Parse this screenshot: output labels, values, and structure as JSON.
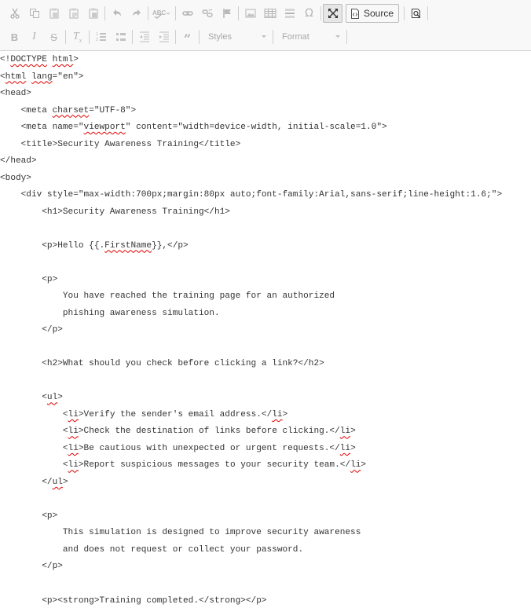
{
  "toolbar": {
    "row1": [
      {
        "name": "cut-button",
        "icon": "scissors-icon"
      },
      {
        "name": "copy-button",
        "icon": "copy-icon"
      },
      {
        "name": "paste-button",
        "icon": "paste-icon"
      },
      {
        "name": "paste-as-text-button",
        "icon": "paste-text-icon"
      },
      {
        "name": "paste-from-word-button",
        "icon": "paste-word-icon"
      },
      {
        "name": "undo-button",
        "icon": "undo-icon"
      },
      {
        "name": "redo-button",
        "icon": "redo-icon"
      },
      {
        "name": "spellcheck-button",
        "icon": "spellcheck-icon"
      },
      {
        "name": "link-button",
        "icon": "link-icon"
      },
      {
        "name": "unlink-button",
        "icon": "unlink-icon"
      },
      {
        "name": "anchor-button",
        "icon": "flag-icon"
      },
      {
        "name": "image-button",
        "icon": "image-icon"
      },
      {
        "name": "table-button",
        "icon": "table-icon"
      },
      {
        "name": "horizontal-line-button",
        "icon": "horizontal-rule-icon"
      },
      {
        "name": "special-char-button",
        "icon": "omega-icon"
      },
      {
        "name": "maximize-button",
        "icon": "maximize-icon"
      }
    ],
    "source_label": "Source",
    "row2": [
      {
        "name": "bold-button",
        "icon": "bold-icon"
      },
      {
        "name": "italic-button",
        "icon": "italic-icon"
      },
      {
        "name": "strike-button",
        "icon": "strikethrough-icon"
      },
      {
        "name": "remove-format-button",
        "icon": "remove-format-icon"
      },
      {
        "name": "numbered-list-button",
        "icon": "numbered-list-icon"
      },
      {
        "name": "bulleted-list-button",
        "icon": "bulleted-list-icon"
      },
      {
        "name": "outdent-button",
        "icon": "outdent-icon"
      },
      {
        "name": "indent-button",
        "icon": "indent-icon"
      },
      {
        "name": "blockquote-button",
        "icon": "blockquote-icon"
      }
    ],
    "styles_label": "Styles",
    "format_label": "Format"
  },
  "source_lines": [
    "<!DOCTYPE html>",
    "<html lang=\"en\">",
    "<head>",
    "    <meta charset=\"UTF-8\">",
    "    <meta name=\"viewport\" content=\"width=device-width, initial-scale=1.0\">",
    "    <title>Security Awareness Training</title>",
    "</head>",
    "<body>",
    "    <div style=\"max-width:700px;margin:80px auto;font-family:Arial,sans-serif;line-height:1.6;\">",
    "        <h1>Security Awareness Training</h1>",
    "",
    "        <p>Hello {{.FirstName}},</p>",
    "",
    "        <p>",
    "            You have reached the training page for an authorized",
    "            phishing awareness simulation.",
    "        </p>",
    "",
    "        <h2>What should you check before clicking a link?</h2>",
    "",
    "        <ul>",
    "            <li>Verify the sender's email address.</li>",
    "            <li>Check the destination of links before clicking.</li>",
    "            <li>Be cautious with unexpected or urgent requests.</li>",
    "            <li>Report suspicious messages to your security team.</li>",
    "        </ul>",
    "",
    "        <p>",
    "            This simulation is designed to improve security awareness",
    "            and does not request or collect your password.",
    "        </p>",
    "",
    "        <p><strong>Training completed.</strong></p>"
  ],
  "spellcheck_marked": [
    "DOCTYPE",
    "html",
    "lang",
    "charset",
    "viewport",
    "FirstName",
    "ul",
    "li"
  ]
}
